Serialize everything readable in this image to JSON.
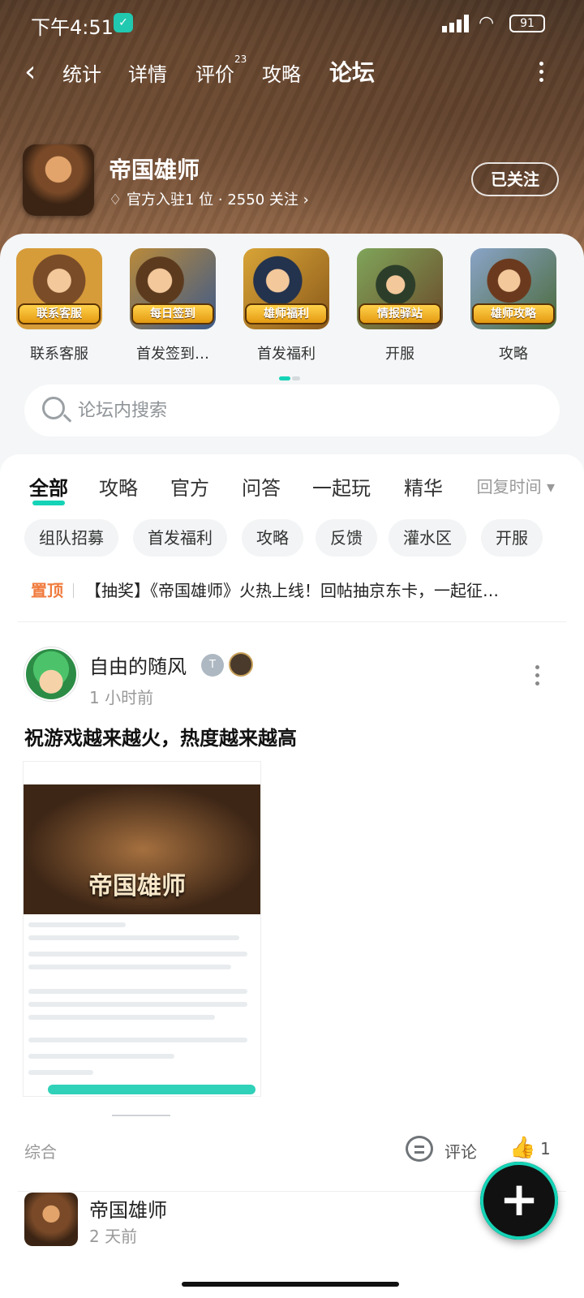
{
  "status": {
    "time": "下午4:51",
    "battery": "91"
  },
  "nav": {
    "tabs": [
      {
        "label": "统计"
      },
      {
        "label": "详情"
      },
      {
        "label": "评价"
      },
      {
        "label": "攻略"
      },
      {
        "label": "论坛"
      }
    ],
    "review_count": "23"
  },
  "game": {
    "title": "帝国雄师",
    "meta": "官方入驻1 位 · 2550 关注 ›",
    "follow_label": "已关注"
  },
  "shortcuts": [
    {
      "label": "联系客服",
      "ribbon": "联系客服",
      "icon": "support-illustration"
    },
    {
      "label": "首发签到…",
      "ribbon": "每日签到",
      "icon": "checkin-illustration"
    },
    {
      "label": "首发福利",
      "ribbon": "雄师福利",
      "icon": "gift-illustration"
    },
    {
      "label": "开服",
      "ribbon": "情报驿站",
      "icon": "outpost-illustration"
    },
    {
      "label": "攻略",
      "ribbon": "雄师攻略",
      "icon": "guide-illustration"
    }
  ],
  "search": {
    "placeholder": "论坛内搜索"
  },
  "feed": {
    "tabs": [
      "全部",
      "攻略",
      "官方",
      "问答",
      "一起玩",
      "精华"
    ],
    "sort_label": "回复时间 ▾",
    "chips": [
      "组队招募",
      "首发福利",
      "攻略",
      "反馈",
      "灌水区",
      "开服"
    ],
    "pinned": {
      "tag": "置顶",
      "text": "【抽奖】《帝国雄师》火热上线！回帖抽京东卡，一起征…"
    }
  },
  "posts": [
    {
      "author": "自由的随风",
      "time": "1 小时前",
      "title": "祝游戏越来越火，热度越来越高",
      "screenshot_title": "帝国雄师",
      "category": "综合",
      "comment_label": "评论",
      "likes": "1"
    },
    {
      "author": "帝国雄师",
      "time": "2 天前"
    }
  ],
  "colors": {
    "accent": "#15d3b6",
    "pinned": "#f07a3c"
  }
}
